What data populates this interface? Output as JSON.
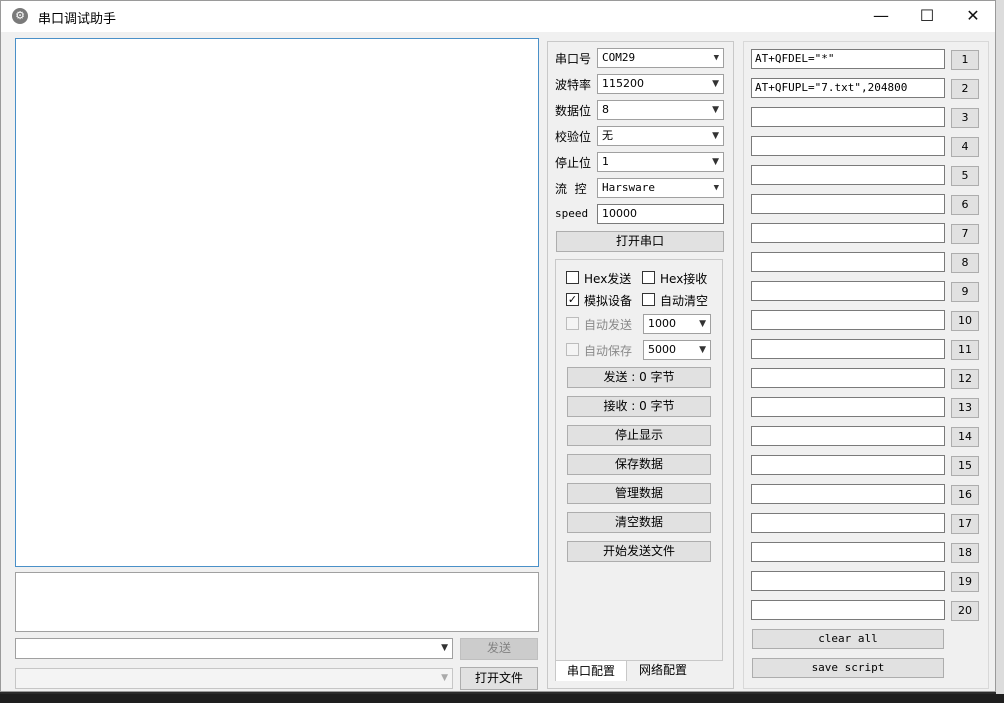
{
  "window": {
    "title": "串口调试助手",
    "icon": "gear-icon",
    "minimize_glyph": "—",
    "maximize_glyph": "☐",
    "close_glyph": "✕"
  },
  "left": {
    "send_button": "发送",
    "open_file_button": "打开文件"
  },
  "config": {
    "port_label": "串口号",
    "port_value": "COM29",
    "baud_label": "波特率",
    "baud_value": "115200",
    "databits_label": "数据位",
    "databits_value": "8",
    "parity_label": "校验位",
    "parity_value": "无",
    "stopbits_label": "停止位",
    "stopbits_value": "1",
    "flow_label": "流  控",
    "flow_value": "Harsware",
    "speed_label": "speed",
    "speed_value": "10000",
    "open_port_button": "打开串口"
  },
  "options": {
    "hex_send": {
      "label": "Hex发送",
      "checked": false
    },
    "hex_recv": {
      "label": "Hex接收",
      "checked": false
    },
    "simulate": {
      "label": "模拟设备",
      "checked": true
    },
    "auto_clear": {
      "label": "自动清空",
      "checked": false
    },
    "auto_send": {
      "label": "自动发送",
      "value": "1000"
    },
    "auto_save": {
      "label": "自动保存",
      "value": "5000"
    },
    "check_glyph": "✓"
  },
  "actions": [
    "发送 : 0 字节",
    "接收 : 0 字节",
    "停止显示",
    "保存数据",
    "管理数据",
    "清空数据",
    "开始发送文件"
  ],
  "tabs": [
    "串口配置",
    "网络配置"
  ],
  "scripts": {
    "items": [
      {
        "value": "AT+QFDEL=\"*\"",
        "num": "1"
      },
      {
        "value": "AT+QFUPL=\"7.txt\",204800",
        "num": "2"
      },
      {
        "value": "",
        "num": "3"
      },
      {
        "value": "",
        "num": "4"
      },
      {
        "value": "",
        "num": "5"
      },
      {
        "value": "",
        "num": "6"
      },
      {
        "value": "",
        "num": "7"
      },
      {
        "value": "",
        "num": "8"
      },
      {
        "value": "",
        "num": "9"
      },
      {
        "value": "",
        "num": "10"
      },
      {
        "value": "",
        "num": "11"
      },
      {
        "value": "",
        "num": "12"
      },
      {
        "value": "",
        "num": "13"
      },
      {
        "value": "",
        "num": "14"
      },
      {
        "value": "",
        "num": "15"
      },
      {
        "value": "",
        "num": "16"
      },
      {
        "value": "",
        "num": "17"
      },
      {
        "value": "",
        "num": "18"
      },
      {
        "value": "",
        "num": "19"
      },
      {
        "value": "",
        "num": "20"
      }
    ],
    "clear_all": "clear all",
    "save_script": "save script"
  },
  "dropdown_glyph": "▼"
}
